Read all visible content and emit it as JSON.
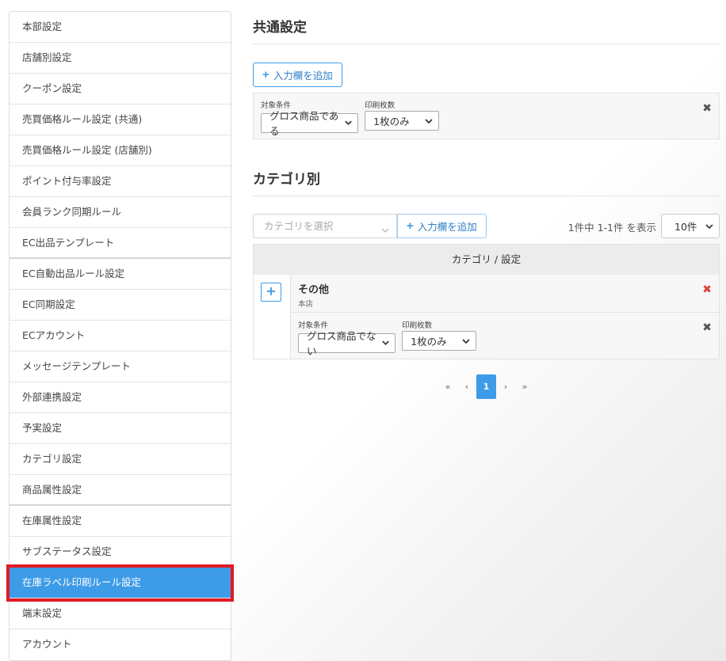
{
  "sidebar": {
    "items": [
      {
        "label": "本部設定"
      },
      {
        "label": "店舗別設定"
      },
      {
        "label": "クーポン設定"
      },
      {
        "label": "売買価格ルール設定 (共通)"
      },
      {
        "label": "売買価格ルール設定 (店舗別)"
      },
      {
        "label": "ポイント付与率設定"
      },
      {
        "label": "会員ランク同期ルール"
      },
      {
        "label": "EC出品テンプレート"
      },
      {
        "label": "EC自動出品ルール設定"
      },
      {
        "label": "EC同期設定"
      },
      {
        "label": "ECアカウント"
      },
      {
        "label": "メッセージテンプレート"
      },
      {
        "label": "外部連携設定"
      },
      {
        "label": "予実設定"
      },
      {
        "label": "カテゴリ設定"
      },
      {
        "label": "商品属性設定"
      },
      {
        "label": "在庫属性設定"
      },
      {
        "label": "サブステータス設定"
      },
      {
        "label": "在庫ラベル印刷ルール設定"
      },
      {
        "label": "端末設定"
      },
      {
        "label": "アカウント"
      }
    ],
    "active_index": 18
  },
  "common": {
    "title": "共通設定",
    "add_button": "入力欄を追加",
    "condition_label": "対象条件",
    "condition_value": "グロス商品である",
    "print_label": "印刷枚数",
    "print_value": "1枚のみ"
  },
  "category": {
    "title": "カテゴリ別",
    "select_placeholder": "カテゴリを選択",
    "add_button": "入力欄を追加",
    "count_text": "1件中 1-1件 を表示",
    "per_page": "10件",
    "table_header": "カテゴリ / 設定",
    "row_name": "その他",
    "row_sub": "本店",
    "condition_label": "対象条件",
    "condition_value": "グロス商品でない",
    "print_label": "印刷枚数",
    "print_value": "1枚のみ"
  },
  "pagination": {
    "first": "«",
    "prev": "‹",
    "current": "1",
    "next": "›",
    "last": "»"
  },
  "icons": {
    "plus": "+",
    "close": "✖"
  },
  "colors": {
    "accent": "#3e9be8",
    "active_outline": "#e01b24",
    "delete_red": "#e0443f"
  }
}
